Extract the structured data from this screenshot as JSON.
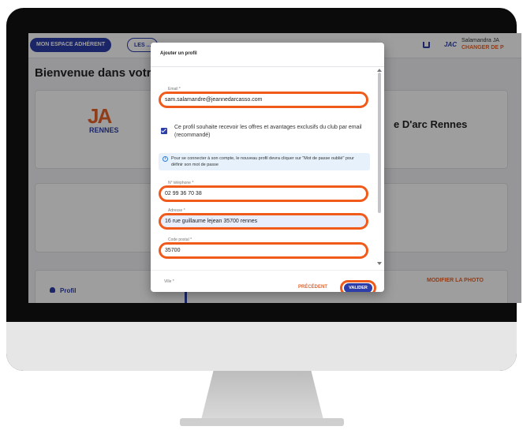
{
  "topbar": {
    "nav_active": "MON ESPACE ADHÉRENT",
    "nav_second": "LES ...",
    "brand_short": "JAC",
    "user_name": "Salamandra JA",
    "change_link": "CHANGER DE P"
  },
  "page": {
    "welcome": "Bienvenue dans votr",
    "club_name": "e D'arc Rennes",
    "logo_main": "JA",
    "logo_sub": "RENNES",
    "profile_tab": "Profil",
    "modify_photo": "MODIFIER LA PHOTO"
  },
  "dialog": {
    "title": "Ajouter un profil",
    "email": {
      "label": "Email *",
      "value": "sam.salamandre@jeannedarcasso.com"
    },
    "newsletter": {
      "checked": true,
      "text": "Ce profil souhaite recevoir les offres et avantages exclusifs du club par email (recommandé)"
    },
    "info": "Pour se connecter à son compte, le nouveau profil devra cliquer sur \"Mot de passe oublié\" pour définir son mot de passe",
    "phone": {
      "label": "N° téléphone *",
      "value": "02 99 36 70 38"
    },
    "address": {
      "label": "Adresse *",
      "value": "16 rue guillaume lejean 35700 rennes"
    },
    "postal": {
      "label": "Code postal *",
      "value": "35700"
    },
    "city": {
      "label": "Ville *"
    },
    "prev_button": "PRÉCÉDENT",
    "submit_button": "VALIDER"
  },
  "colors": {
    "primary": "#2d3ea8",
    "accent": "#e8642a",
    "highlight": "#f05a1a"
  }
}
